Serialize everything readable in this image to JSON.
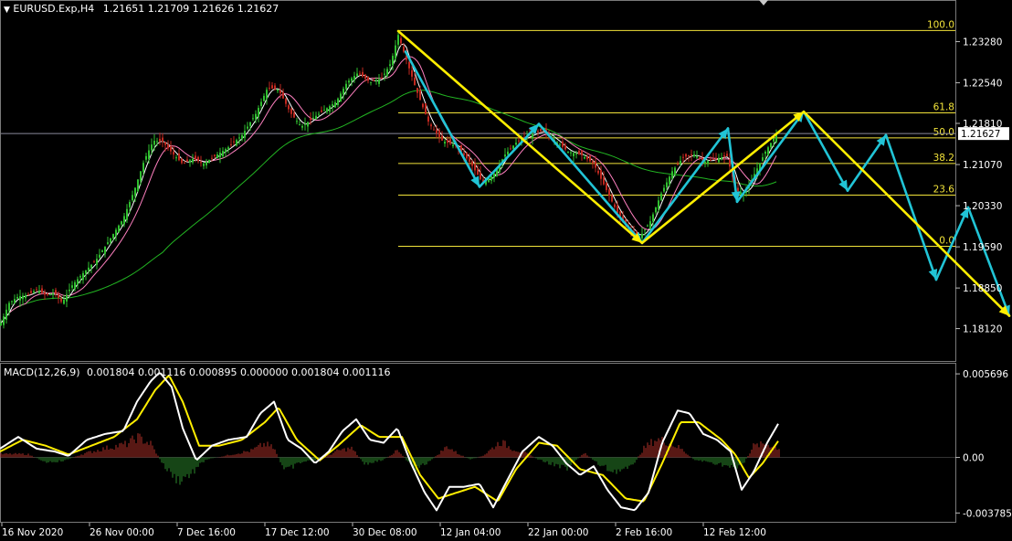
{
  "header": {
    "symbol": "EURUSD.Exp,H4",
    "ohlc": "1.21651 1.21709 1.21626 1.21627"
  },
  "macd_header": {
    "label": "MACD(12,26,9)",
    "values": "0.001804 0.001116 0.000895 0.000000 0.001804 0.001116"
  },
  "colors": {
    "background": "#000000",
    "candle_bull": "#2fbf2f",
    "candle_bear": "#c0281f",
    "fib": "#f2e33a",
    "yellow_arrow": "#ffee00",
    "cyan_arrow": "#21c4d6",
    "sma_green": "#22b422",
    "ma_white": "#ffffff",
    "ma_pink": "#ff80c0",
    "macd_signal": "#ffee00",
    "macd_line": "#ffffff",
    "hist_pos": "#b03028",
    "hist_neg": "#2c8a2c",
    "current_price_line": "#8a8a9a"
  },
  "chart_data": [
    {
      "type": "candlestick",
      "title": "EURUSD.Exp,H4",
      "y_ticks": [
        "1.23280",
        "1.22540",
        "1.21810",
        "1.21070",
        "1.20330",
        "1.19590",
        "1.18850",
        "1.18120"
      ],
      "ylim": [
        1.1785,
        1.237
      ],
      "current_price": "1.21627",
      "x_ticks": [
        "16 Nov 2020",
        "26 Nov 00:00",
        "7 Dec 16:00",
        "17 Dec 12:00",
        "30 Dec 08:00",
        "12 Jan 04:00",
        "22 Jan 00:00",
        "2 Feb 16:00",
        "12 Feb 12:00"
      ],
      "fibonacci_levels": [
        {
          "label": "100.0",
          "price": 1.2348
        },
        {
          "label": "61.8",
          "price": 1.22
        },
        {
          "label": "50.0",
          "price": 1.2155
        },
        {
          "label": "38.2",
          "price": 1.2109
        },
        {
          "label": "23.6",
          "price": 1.2052
        },
        {
          "label": "0.0",
          "price": 1.196
        }
      ],
      "price_path": [
        {
          "x": 0,
          "y": 1.1818
        },
        {
          "x": 10,
          "y": 1.1858
        },
        {
          "x": 20,
          "y": 1.187
        },
        {
          "x": 30,
          "y": 1.1872
        },
        {
          "x": 40,
          "y": 1.1882
        },
        {
          "x": 50,
          "y": 1.1872
        },
        {
          "x": 60,
          "y": 1.1876
        },
        {
          "x": 68,
          "y": 1.1858
        },
        {
          "x": 78,
          "y": 1.1888
        },
        {
          "x": 90,
          "y": 1.191
        },
        {
          "x": 105,
          "y": 1.1935
        },
        {
          "x": 120,
          "y": 1.1972
        },
        {
          "x": 135,
          "y": 1.201
        },
        {
          "x": 148,
          "y": 1.2065
        },
        {
          "x": 158,
          "y": 1.2115
        },
        {
          "x": 168,
          "y": 1.215
        },
        {
          "x": 178,
          "y": 1.2148
        },
        {
          "x": 190,
          "y": 1.2125
        },
        {
          "x": 200,
          "y": 1.2108
        },
        {
          "x": 212,
          "y": 1.2118
        },
        {
          "x": 222,
          "y": 1.2108
        },
        {
          "x": 235,
          "y": 1.2122
        },
        {
          "x": 250,
          "y": 1.2138
        },
        {
          "x": 265,
          "y": 1.216
        },
        {
          "x": 280,
          "y": 1.2198
        },
        {
          "x": 293,
          "y": 1.2245
        },
        {
          "x": 305,
          "y": 1.2242
        },
        {
          "x": 318,
          "y": 1.22
        },
        {
          "x": 330,
          "y": 1.2175
        },
        {
          "x": 342,
          "y": 1.219
        },
        {
          "x": 355,
          "y": 1.2205
        },
        {
          "x": 368,
          "y": 1.222
        },
        {
          "x": 380,
          "y": 1.2255
        },
        {
          "x": 392,
          "y": 1.2272
        },
        {
          "x": 405,
          "y": 1.2255
        },
        {
          "x": 418,
          "y": 1.2262
        },
        {
          "x": 428,
          "y": 1.229
        },
        {
          "x": 436,
          "y": 1.234
        },
        {
          "x": 444,
          "y": 1.23
        },
        {
          "x": 456,
          "y": 1.224
        },
        {
          "x": 470,
          "y": 1.218
        },
        {
          "x": 484,
          "y": 1.215
        },
        {
          "x": 500,
          "y": 1.214
        },
        {
          "x": 515,
          "y": 1.211
        },
        {
          "x": 528,
          "y": 1.2075
        },
        {
          "x": 540,
          "y": 1.2088
        },
        {
          "x": 553,
          "y": 1.2125
        },
        {
          "x": 566,
          "y": 1.2148
        },
        {
          "x": 580,
          "y": 1.216
        },
        {
          "x": 594,
          "y": 1.2168
        },
        {
          "x": 608,
          "y": 1.215
        },
        {
          "x": 622,
          "y": 1.213
        },
        {
          "x": 636,
          "y": 1.2125
        },
        {
          "x": 650,
          "y": 1.2108
        },
        {
          "x": 662,
          "y": 1.2068
        },
        {
          "x": 676,
          "y": 1.202
        },
        {
          "x": 690,
          "y": 1.199
        },
        {
          "x": 700,
          "y": 1.1975
        },
        {
          "x": 712,
          "y": 1.2005
        },
        {
          "x": 724,
          "y": 1.2055
        },
        {
          "x": 736,
          "y": 1.2095
        },
        {
          "x": 748,
          "y": 1.212
        },
        {
          "x": 760,
          "y": 1.2125
        },
        {
          "x": 772,
          "y": 1.2112
        },
        {
          "x": 784,
          "y": 1.2118
        },
        {
          "x": 796,
          "y": 1.2122
        },
        {
          "x": 806,
          "y": 1.206
        },
        {
          "x": 816,
          "y": 1.2055
        },
        {
          "x": 826,
          "y": 1.209
        },
        {
          "x": 838,
          "y": 1.213
        },
        {
          "x": 850,
          "y": 1.2162
        }
      ],
      "yellow_arrows": [
        {
          "from": {
            "x": 436,
            "y": 1.2347
          },
          "to": {
            "x": 703,
            "y": 1.1966
          }
        },
        {
          "from": {
            "x": 703,
            "y": 1.1966
          },
          "to": {
            "x": 880,
            "y": 1.2202
          }
        },
        {
          "from": {
            "x": 880,
            "y": 1.2202
          },
          "to": {
            "x": 1105,
            "y": 1.1835
          }
        }
      ],
      "cyan_path": [
        {
          "x": 444,
          "y": 1.231
        },
        {
          "x": 525,
          "y": 1.2067
        },
        {
          "x": 590,
          "y": 1.218
        },
        {
          "x": 703,
          "y": 1.1966
        },
        {
          "x": 797,
          "y": 1.2172
        },
        {
          "x": 807,
          "y": 1.204
        },
        {
          "x": 880,
          "y": 1.2202
        },
        {
          "x": 928,
          "y": 1.206
        },
        {
          "x": 970,
          "y": 1.216
        },
        {
          "x": 1025,
          "y": 1.19
        },
        {
          "x": 1060,
          "y": 1.203
        },
        {
          "x": 1105,
          "y": 1.1835
        }
      ]
    },
    {
      "type": "histogram+line",
      "title": "MACD(12,26,9)",
      "y_ticks": [
        "0.005696",
        "0.00",
        "-0.003785"
      ],
      "ylim": [
        -0.0042,
        0.0062
      ],
      "macd_line": [
        {
          "x": 0,
          "y": 0.0006
        },
        {
          "x": 20,
          "y": 0.0014
        },
        {
          "x": 40,
          "y": 0.0006
        },
        {
          "x": 60,
          "y": 0.0004
        },
        {
          "x": 75,
          "y": 0.0001
        },
        {
          "x": 95,
          "y": 0.0012
        },
        {
          "x": 115,
          "y": 0.0016
        },
        {
          "x": 135,
          "y": 0.0018
        },
        {
          "x": 150,
          "y": 0.0038
        },
        {
          "x": 165,
          "y": 0.0052
        },
        {
          "x": 175,
          "y": 0.0058
        },
        {
          "x": 188,
          "y": 0.0048
        },
        {
          "x": 200,
          "y": 0.002
        },
        {
          "x": 215,
          "y": -0.0002
        },
        {
          "x": 232,
          "y": 0.0008
        },
        {
          "x": 250,
          "y": 0.0012
        },
        {
          "x": 270,
          "y": 0.0014
        },
        {
          "x": 285,
          "y": 0.003
        },
        {
          "x": 300,
          "y": 0.0038
        },
        {
          "x": 315,
          "y": 0.0012
        },
        {
          "x": 330,
          "y": 0.0006
        },
        {
          "x": 345,
          "y": -0.0004
        },
        {
          "x": 360,
          "y": 0.0004
        },
        {
          "x": 375,
          "y": 0.0018
        },
        {
          "x": 390,
          "y": 0.0026
        },
        {
          "x": 405,
          "y": 0.0012
        },
        {
          "x": 420,
          "y": 0.001
        },
        {
          "x": 435,
          "y": 0.002
        },
        {
          "x": 450,
          "y": -0.0004
        },
        {
          "x": 465,
          "y": -0.0024
        },
        {
          "x": 478,
          "y": -0.0036
        },
        {
          "x": 492,
          "y": -0.002
        },
        {
          "x": 508,
          "y": -0.002
        },
        {
          "x": 525,
          "y": -0.0018
        },
        {
          "x": 540,
          "y": -0.0034
        },
        {
          "x": 555,
          "y": -0.0016
        },
        {
          "x": 572,
          "y": 0.0004
        },
        {
          "x": 590,
          "y": 0.0014
        },
        {
          "x": 605,
          "y": 0.0008
        },
        {
          "x": 620,
          "y": -0.0004
        },
        {
          "x": 635,
          "y": -0.0012
        },
        {
          "x": 650,
          "y": -0.0006
        },
        {
          "x": 665,
          "y": -0.0022
        },
        {
          "x": 680,
          "y": -0.0034
        },
        {
          "x": 695,
          "y": -0.0036
        },
        {
          "x": 710,
          "y": -0.0024
        },
        {
          "x": 725,
          "y": 0.001
        },
        {
          "x": 742,
          "y": 0.0032
        },
        {
          "x": 755,
          "y": 0.003
        },
        {
          "x": 770,
          "y": 0.0016
        },
        {
          "x": 785,
          "y": 0.0012
        },
        {
          "x": 800,
          "y": 0.0004
        },
        {
          "x": 812,
          "y": -0.0022
        },
        {
          "x": 825,
          "y": -0.001
        },
        {
          "x": 840,
          "y": 0.001
        },
        {
          "x": 853,
          "y": 0.0024
        }
      ],
      "signal_line": [
        {
          "x": 0,
          "y": 0.0004
        },
        {
          "x": 25,
          "y": 0.0012
        },
        {
          "x": 50,
          "y": 0.0008
        },
        {
          "x": 75,
          "y": 0.0002
        },
        {
          "x": 100,
          "y": 0.0008
        },
        {
          "x": 125,
          "y": 0.0014
        },
        {
          "x": 150,
          "y": 0.0026
        },
        {
          "x": 170,
          "y": 0.0046
        },
        {
          "x": 185,
          "y": 0.0056
        },
        {
          "x": 200,
          "y": 0.0038
        },
        {
          "x": 218,
          "y": 0.0008
        },
        {
          "x": 240,
          "y": 0.0008
        },
        {
          "x": 265,
          "y": 0.0012
        },
        {
          "x": 290,
          "y": 0.0024
        },
        {
          "x": 305,
          "y": 0.0034
        },
        {
          "x": 325,
          "y": 0.0012
        },
        {
          "x": 350,
          "y": -0.0002
        },
        {
          "x": 370,
          "y": 0.0008
        },
        {
          "x": 395,
          "y": 0.0022
        },
        {
          "x": 415,
          "y": 0.0014
        },
        {
          "x": 440,
          "y": 0.0014
        },
        {
          "x": 460,
          "y": -0.0012
        },
        {
          "x": 480,
          "y": -0.0028
        },
        {
          "x": 500,
          "y": -0.0024
        },
        {
          "x": 520,
          "y": -0.002
        },
        {
          "x": 545,
          "y": -0.003
        },
        {
          "x": 565,
          "y": -0.0008
        },
        {
          "x": 590,
          "y": 0.001
        },
        {
          "x": 610,
          "y": 0.0008
        },
        {
          "x": 635,
          "y": -0.0008
        },
        {
          "x": 660,
          "y": -0.0012
        },
        {
          "x": 685,
          "y": -0.0028
        },
        {
          "x": 705,
          "y": -0.003
        },
        {
          "x": 725,
          "y": -0.0004
        },
        {
          "x": 745,
          "y": 0.0024
        },
        {
          "x": 765,
          "y": 0.0024
        },
        {
          "x": 790,
          "y": 0.0012
        },
        {
          "x": 805,
          "y": 0.0002
        },
        {
          "x": 820,
          "y": -0.0014
        },
        {
          "x": 835,
          "y": -0.0004
        },
        {
          "x": 853,
          "y": 0.0012
        }
      ],
      "histogram_envelope": [
        {
          "x": 0,
          "y": 0.0003
        },
        {
          "x": 30,
          "y": 0.0003
        },
        {
          "x": 50,
          "y": -0.0004
        },
        {
          "x": 70,
          "y": -0.0003
        },
        {
          "x": 90,
          "y": 0.0003
        },
        {
          "x": 115,
          "y": 0.0008
        },
        {
          "x": 140,
          "y": 0.0012
        },
        {
          "x": 150,
          "y": 0.0018
        },
        {
          "x": 165,
          "y": 0.0012
        },
        {
          "x": 180,
          "y": -0.0008
        },
        {
          "x": 195,
          "y": -0.002
        },
        {
          "x": 210,
          "y": -0.0014
        },
        {
          "x": 225,
          "y": -0.0002
        },
        {
          "x": 250,
          "y": 0.0002
        },
        {
          "x": 275,
          "y": 0.0006
        },
        {
          "x": 290,
          "y": 0.0012
        },
        {
          "x": 300,
          "y": 0.0008
        },
        {
          "x": 312,
          "y": -0.0012
        },
        {
          "x": 330,
          "y": -0.0004
        },
        {
          "x": 350,
          "y": -0.0002
        },
        {
          "x": 370,
          "y": 0.0006
        },
        {
          "x": 385,
          "y": 0.0008
        },
        {
          "x": 400,
          "y": -0.0006
        },
        {
          "x": 420,
          "y": -0.0002
        },
        {
          "x": 435,
          "y": 0.0006
        },
        {
          "x": 455,
          "y": -0.001
        },
        {
          "x": 470,
          "y": -0.0004
        },
        {
          "x": 490,
          "y": 0.001
        },
        {
          "x": 500,
          "y": 0.0004
        },
        {
          "x": 515,
          "y": -0.0002
        },
        {
          "x": 530,
          "y": 0.0002
        },
        {
          "x": 548,
          "y": 0.0014
        },
        {
          "x": 560,
          "y": 0.0008
        },
        {
          "x": 575,
          "y": 0.0004
        },
        {
          "x": 590,
          "y": -0.0002
        },
        {
          "x": 605,
          "y": -0.0006
        },
        {
          "x": 620,
          "y": -0.001
        },
        {
          "x": 640,
          "y": 0.0004
        },
        {
          "x": 655,
          "y": -0.0006
        },
        {
          "x": 670,
          "y": -0.0012
        },
        {
          "x": 690,
          "y": -0.001
        },
        {
          "x": 705,
          "y": 0.0008
        },
        {
          "x": 718,
          "y": 0.0016
        },
        {
          "x": 730,
          "y": 0.0014
        },
        {
          "x": 745,
          "y": 0.0008
        },
        {
          "x": 760,
          "y": -0.0002
        },
        {
          "x": 775,
          "y": -0.0004
        },
        {
          "x": 790,
          "y": -0.0006
        },
        {
          "x": 805,
          "y": -0.001
        },
        {
          "x": 815,
          "y": -0.0004
        },
        {
          "x": 825,
          "y": 0.001
        },
        {
          "x": 840,
          "y": 0.0012
        },
        {
          "x": 853,
          "y": 0.0008
        }
      ]
    }
  ]
}
